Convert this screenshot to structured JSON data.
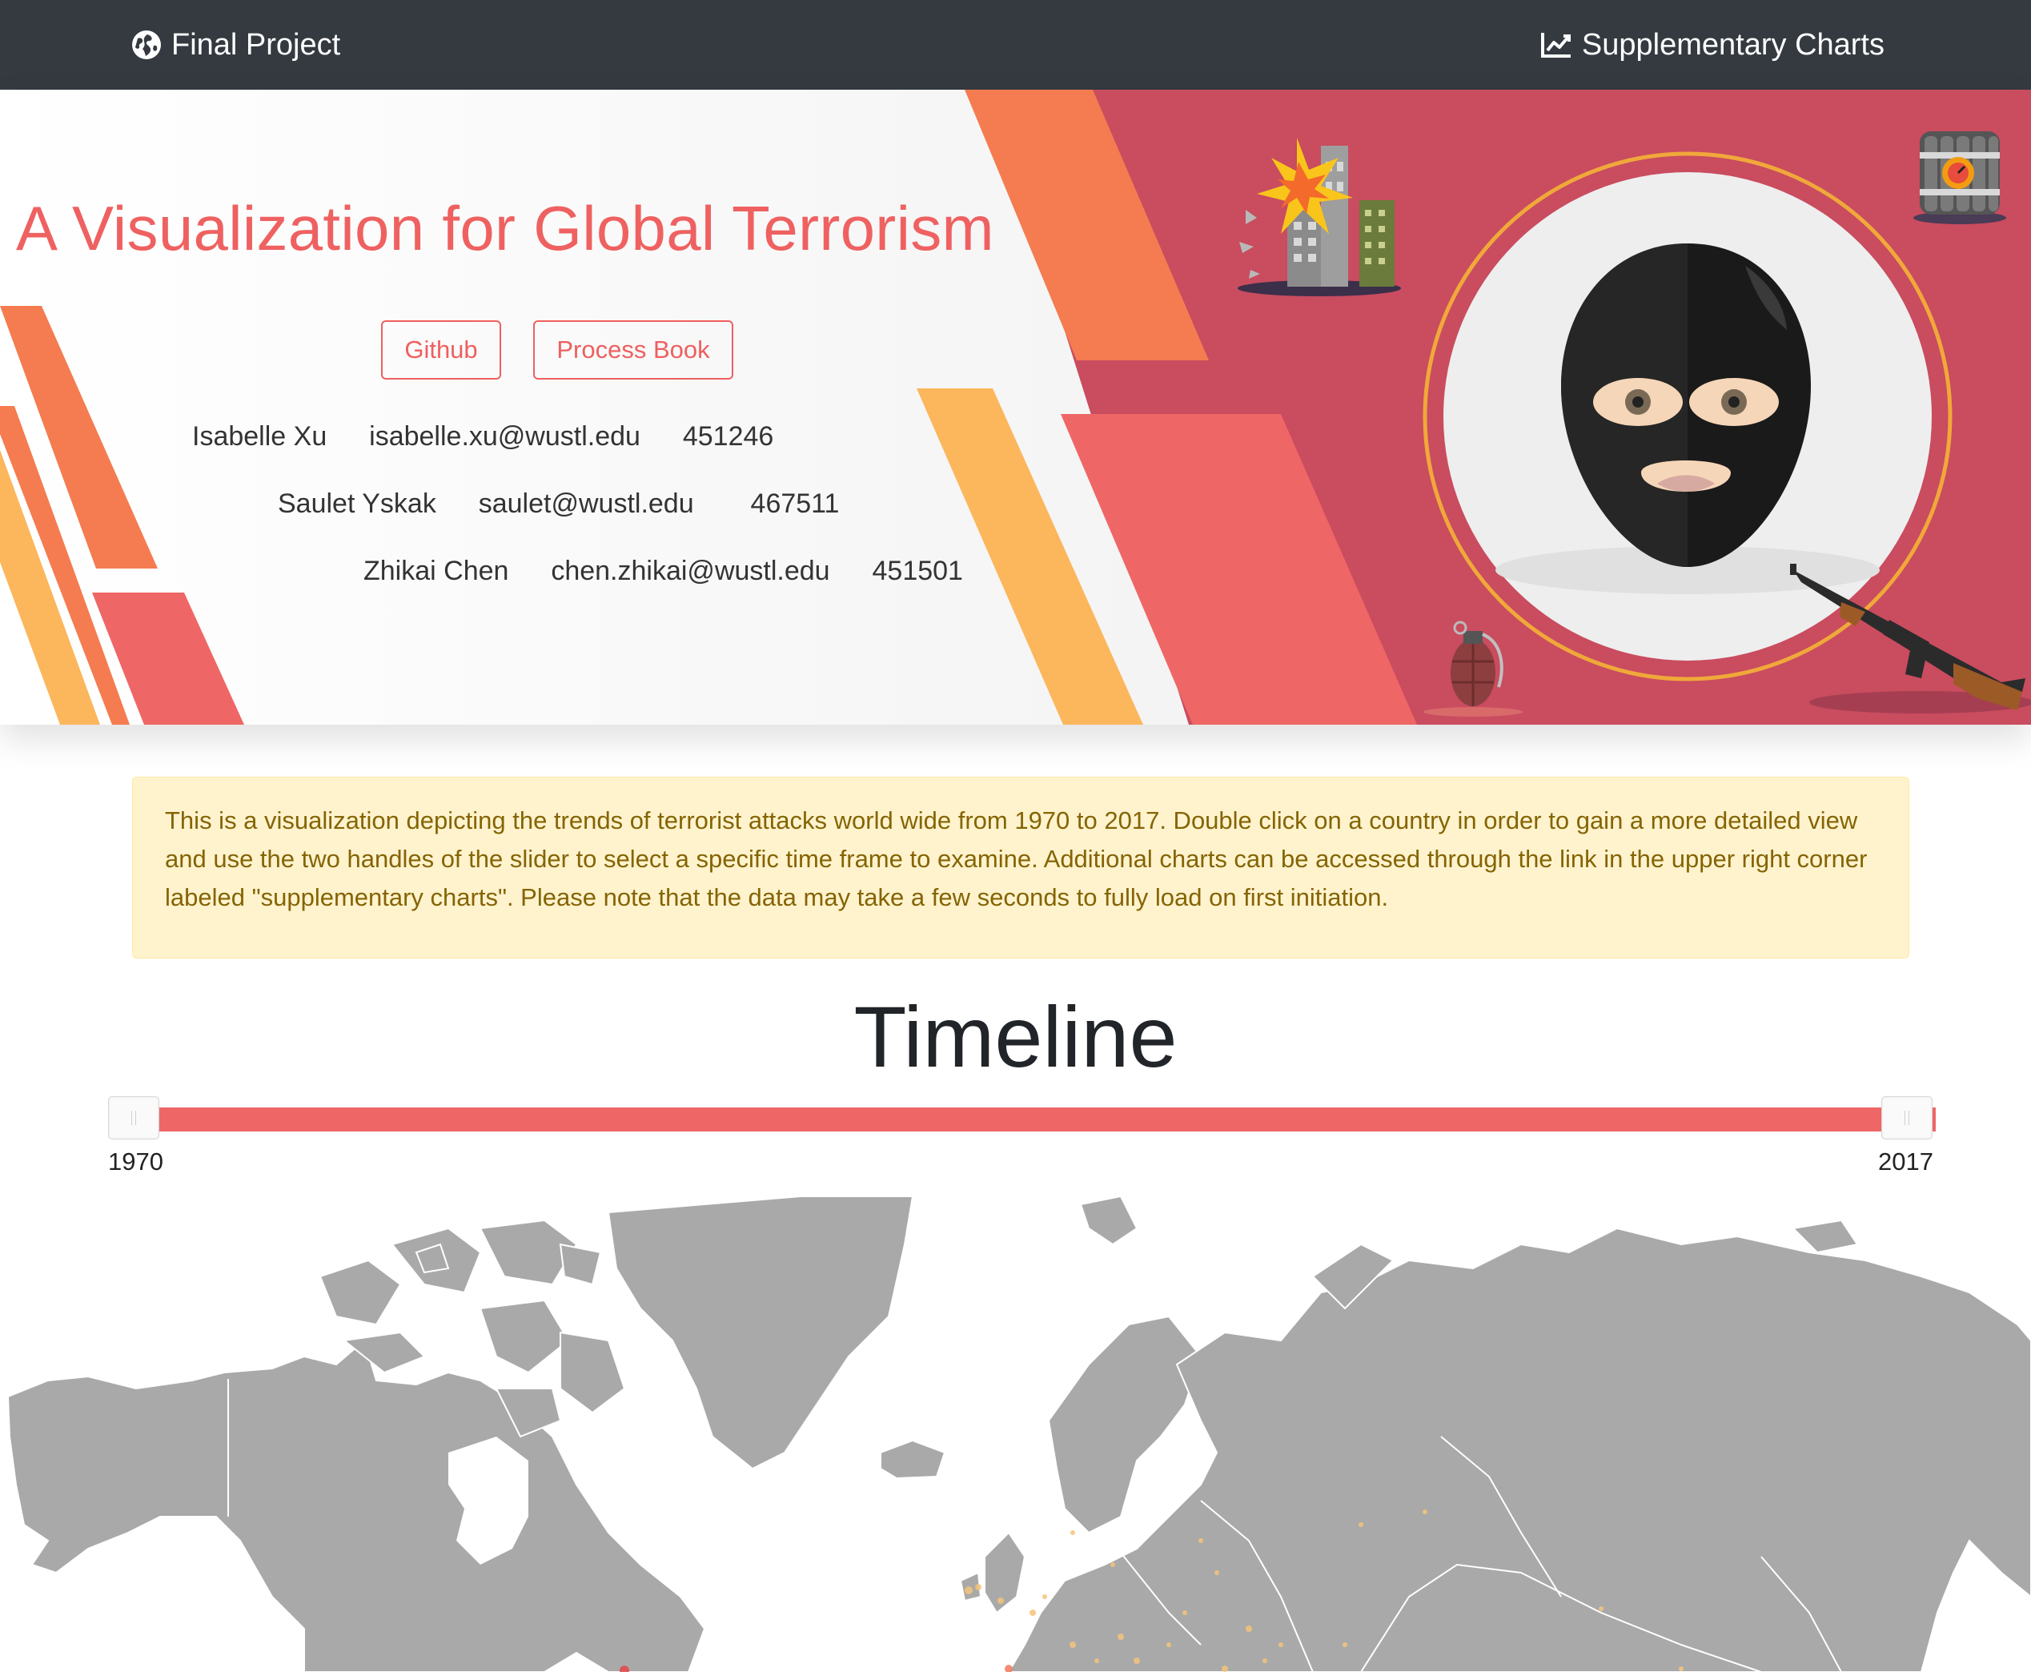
{
  "navbar": {
    "brand_label": "Final Project",
    "brand_icon": "globe-icon",
    "supp_label": "Supplementary Charts",
    "supp_icon": "line-chart-icon"
  },
  "hero": {
    "title": "A Visualization for Global Terrorism",
    "buttons": {
      "github": "Github",
      "process_book": "Process Book"
    },
    "authors": [
      {
        "name": "Isabelle Xu",
        "email": "isabelle.xu@wustl.edu",
        "id": "451246"
      },
      {
        "name": "Saulet Yskak",
        "email": "saulet@wustl.edu",
        "id": "467511"
      },
      {
        "name": "Zhikai Chen",
        "email": "chen.zhikai@wustl.edu",
        "id": "451501"
      }
    ],
    "colors": {
      "title": "#ef6161",
      "panel": "#c94c5f",
      "orange": "#f47c50",
      "yellow": "#fcb65c",
      "coral": "#ef6666"
    }
  },
  "alert": {
    "text": "This is a visualization depicting the trends of terrorist attacks world wide from 1970 to 2017. Double click on a country in order to gain a more detailed view and use the two handles of the slider to select a specific time frame to examine. Additional charts can be accessed through the link in the upper right corner labeled \"supplementary charts\". Please note that the data may take a few seconds to fully load on first initiation."
  },
  "timeline": {
    "title": "Timeline",
    "min_label": "1970",
    "max_label": "2017",
    "range": [
      1970,
      2017
    ]
  },
  "map": {
    "land_color": "#a9a9a9",
    "border_color": "#ffffff",
    "point_color": "#f5c57a"
  }
}
